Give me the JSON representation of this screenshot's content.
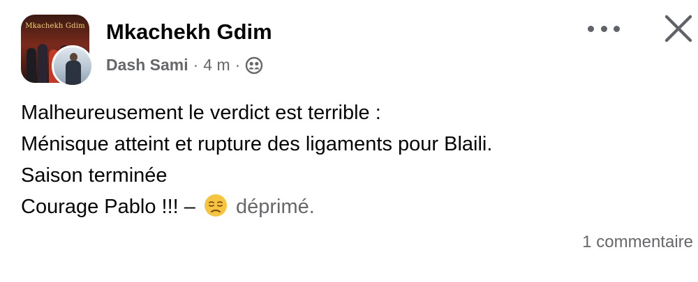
{
  "post": {
    "group_name": "Mkachekh Gdim",
    "group_avatar_text": "Mkachekh Gdim",
    "author_name": "Dash Sami",
    "separator": "·",
    "timestamp": "4 m",
    "audience_icon": "group-audience-icon",
    "lines": [
      "Malheureusement le verdict est terrible :",
      "Ménisque atteint et rupture des ligaments pour Blaili.",
      "Saison terminée",
      "Courage Pablo !!! –"
    ],
    "feeling_emoji": "pensive-face-emoji",
    "feeling_text": "déprimé.",
    "comment_count": "1 commentaire"
  },
  "header": {
    "more_icon": "more-options-icon",
    "close_icon": "close-icon"
  },
  "colors": {
    "text_primary": "#050505",
    "text_secondary": "#65676b",
    "background": "#ffffff",
    "emoji": "#f5c542"
  }
}
